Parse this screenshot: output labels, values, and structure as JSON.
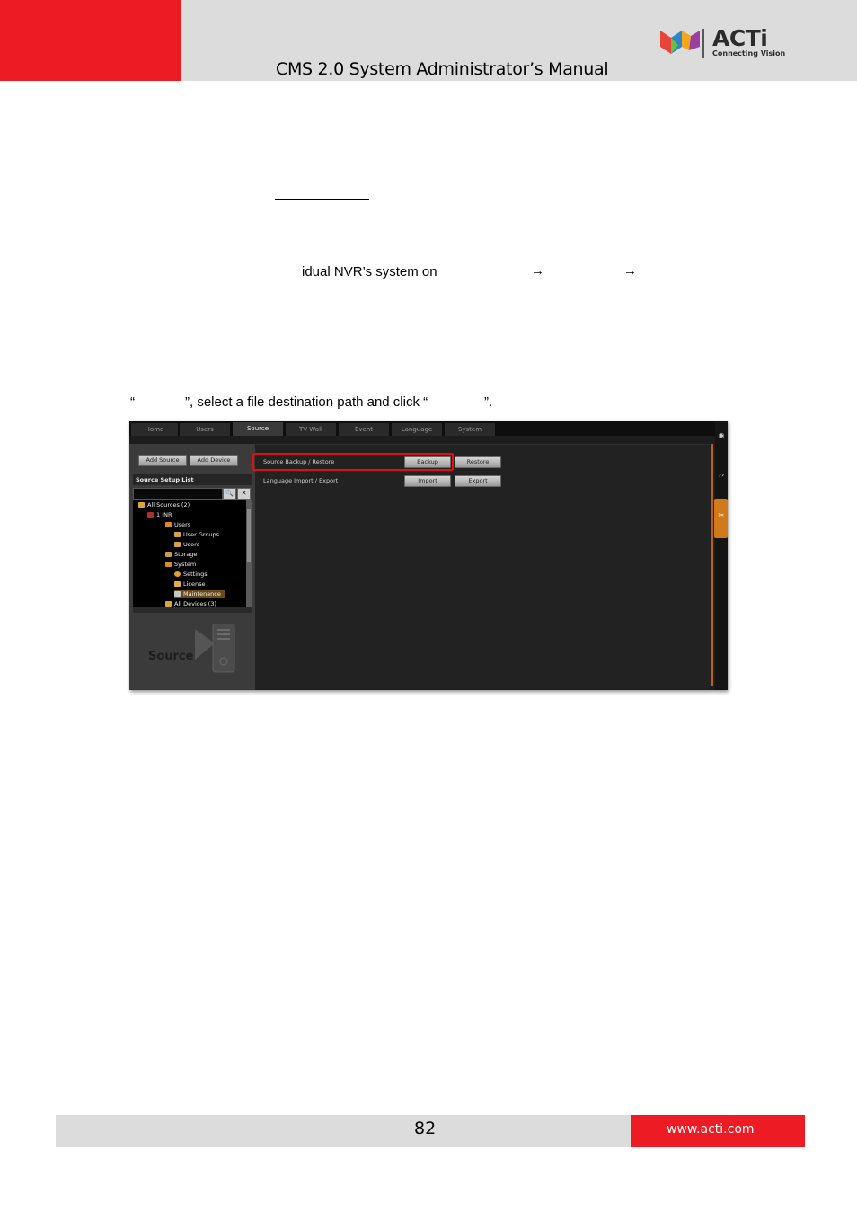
{
  "header": {
    "title": "CMS 2.0 System Administrator’s Manual",
    "logo_text": "ACTi",
    "logo_tagline": "Connecting Vision"
  },
  "body": {
    "fragment_1": "idual NVR’s system on",
    "arrow_symbol": "→",
    "fragment_2_open": "“",
    "fragment_2_mid": "”, select a file destination path and click “",
    "fragment_2_close": "”."
  },
  "screenshot": {
    "tabs": [
      {
        "label": "Home",
        "active": false
      },
      {
        "label": "Users",
        "active": false
      },
      {
        "label": "Source",
        "active": true
      },
      {
        "label": "TV Wall",
        "active": false
      },
      {
        "label": "Event",
        "active": false
      },
      {
        "label": "Language",
        "active": false
      },
      {
        "label": "System",
        "active": false
      }
    ],
    "add_source_label": "Add Source",
    "add_device_label": "Add Device",
    "list_title": "Source Setup List",
    "search_icon": "🔍",
    "clear_icon": "✕",
    "tree": [
      {
        "label": "All Sources (2)",
        "icon": "folder-icon"
      },
      {
        "label": "1 INR",
        "icon": "nvr-icon"
      },
      {
        "label": "Users",
        "icon": "users-icon"
      },
      {
        "label": "User Groups",
        "icon": "user-groups-icon"
      },
      {
        "label": "Users",
        "icon": "user-icon"
      },
      {
        "label": "Storage",
        "icon": "storage-icon"
      },
      {
        "label": "System",
        "icon": "system-icon"
      },
      {
        "label": "Settings",
        "icon": "settings-icon"
      },
      {
        "label": "License",
        "icon": "license-icon"
      },
      {
        "label": "Maintenance",
        "icon": "maintenance-icon",
        "selected": true
      },
      {
        "label": "All Devices (3)",
        "icon": "camera-icon"
      }
    ],
    "watermark": "Source",
    "rows": [
      {
        "label": "Source Backup / Restore",
        "btn1": "Backup",
        "btn2": "Restore"
      },
      {
        "label": "Language Import / Export",
        "btn1": "Import",
        "btn2": "Export"
      }
    ],
    "rail_icons": [
      "eye-icon",
      "forward-icon",
      "tools-icon"
    ],
    "rail_glyphs": [
      "◉",
      "››",
      "✂"
    ],
    "highlight_color": "#e01010",
    "accent_color": "#d07a1c"
  },
  "footer": {
    "page_number": "82",
    "url": "www.acti.com"
  },
  "colors": {
    "brand_red": "#ed1c24",
    "band_gray": "#dcdcdc"
  }
}
